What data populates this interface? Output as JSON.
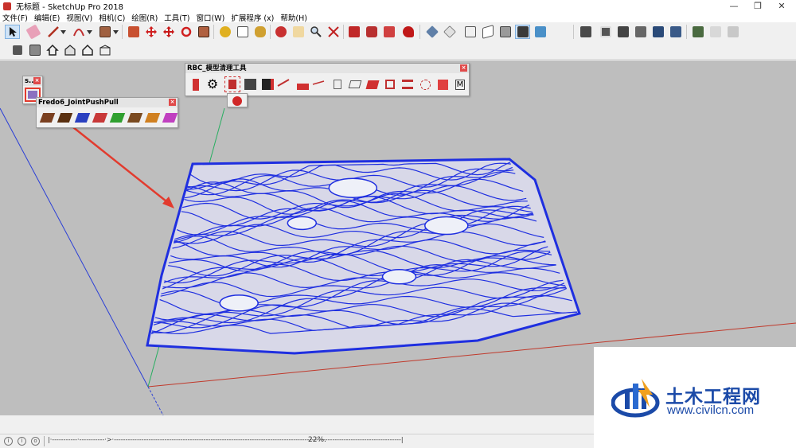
{
  "window": {
    "title": "无标题 - SketchUp Pro 2018",
    "controls": {
      "minimize": "—",
      "maximize": "❐",
      "close": "✕"
    }
  },
  "menu": [
    "文件(F)",
    "编辑(E)",
    "视图(V)",
    "相机(C)",
    "绘图(R)",
    "工具(T)",
    "窗口(W)",
    "扩展程序 (x)",
    "帮助(H)"
  ],
  "palettes": {
    "small": {
      "title": "s..."
    },
    "fredo": {
      "title": "Fredo6_JointPushPull"
    },
    "rbc": {
      "title": "RBC_模型清理工具"
    }
  },
  "status": {
    "hint": "|·-----------·-----------·>·-----------------------------------------------------------------------------------------------------------------------------|",
    "zoom": "22%."
  },
  "watermark": {
    "name": "土木工程网",
    "url": "www.civilcn.com"
  },
  "colors": {
    "terrain_lines": "#1f2fe0",
    "viewport_bg": "#bebebe",
    "axis_red": "#c0392b",
    "axis_green": "#27ae60",
    "axis_blue": "#2b3fd6",
    "arrow": "#e23b2e",
    "watermark_blue": "#1b4aa8"
  },
  "icons": {
    "toolbar_row1": [
      "select-arrow-icon",
      "eraser-icon",
      "pencil-icon",
      "arc-icon",
      "rectangle-icon",
      "push-pull-icon",
      "move-icon",
      "rotate-icon",
      "scale-icon",
      "tape-measure-icon",
      "text-icon",
      "paint-bucket-icon",
      "orbit-icon",
      "pan-icon",
      "zoom-icon",
      "zoom-extents-icon",
      "warehouse-icon",
      "extension-warehouse-icon",
      "layout-icon",
      "ruby-icon",
      "iso-view-icon",
      "top-view-icon",
      "front-view-icon",
      "right-view-icon",
      "back-view-icon",
      "left-view-icon",
      "xray-icon",
      "section-icon",
      "styles-icon"
    ],
    "toolbar_row2": [
      "component-icon",
      "door-icon",
      "house-icon",
      "house2-icon",
      "house3-icon",
      "house4-icon"
    ]
  }
}
